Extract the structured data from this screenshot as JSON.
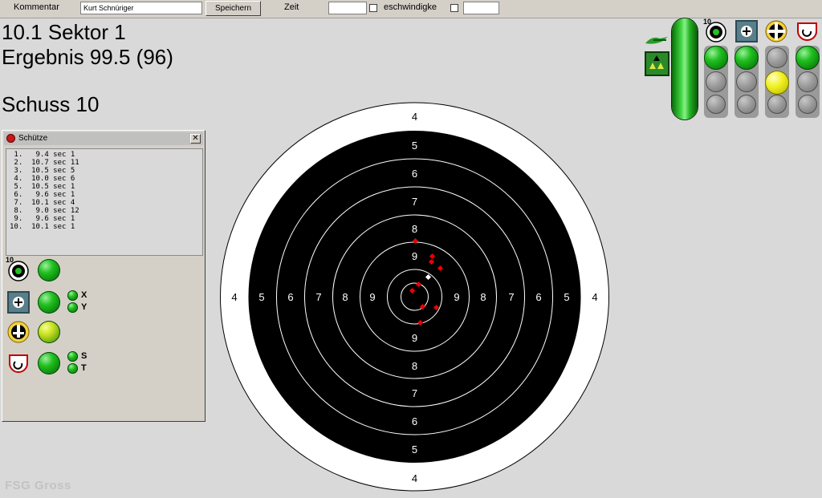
{
  "toolbar": {
    "comment_label": "Kommentar",
    "comment_value": "Kurt Schnüriger",
    "save_label": "Speichern",
    "time_label": "Zeit",
    "time_value": "",
    "speed_label": "eschwindigke",
    "speed_value": ""
  },
  "header": {
    "shot_line": "10.1 Sektor 1",
    "result_line": "Ergebnis 99.5 (96)",
    "shot_number": "Schuss 10"
  },
  "panel": {
    "title": "Schütze",
    "close_glyph": "✕",
    "shots": [
      " 1.   9.4 sec 1",
      " 2.  10.7 sec 11",
      " 3.  10.5 sec 5",
      " 4.  10.0 sec 6",
      " 5.  10.5 sec 1",
      " 6.   9.6 sec 1",
      " 7.  10.1 sec 4",
      " 8.   9.0 sec 12",
      " 9.   9.6 sec 1",
      "10.  10.1 sec 1"
    ],
    "indicators": [
      {
        "icon": "target-10-icon",
        "badge": "10",
        "state": "green"
      },
      {
        "icon": "plus-box-icon",
        "state": "green",
        "sub": [
          "X",
          "Y"
        ]
      },
      {
        "icon": "shooter-icon",
        "state": "yellow-green"
      },
      {
        "icon": "timer-icon",
        "state": "green",
        "sub": [
          "S",
          "T"
        ]
      }
    ]
  },
  "status_signals": {
    "badge_10": "10",
    "columns": [
      {
        "icon": "target-10-icon",
        "lights": [
          "green",
          "gray",
          "gray"
        ]
      },
      {
        "icon": "plus-box-icon",
        "lights": [
          "green",
          "gray",
          "gray"
        ]
      },
      {
        "icon": "crosshair-icon",
        "lights": [
          "gray",
          "yellow",
          "gray"
        ]
      },
      {
        "icon": "timer-icon",
        "lights": [
          "green",
          "gray",
          "gray"
        ]
      }
    ]
  },
  "target": {
    "ring_labels": [
      "4",
      "5",
      "6",
      "7",
      "8",
      "9"
    ],
    "shots_red": 9,
    "last_shot_color": "#ffffff",
    "shot_color": "#ff0000",
    "black_color": "#000000"
  },
  "footer": {
    "watermark": "FSG Gross"
  }
}
